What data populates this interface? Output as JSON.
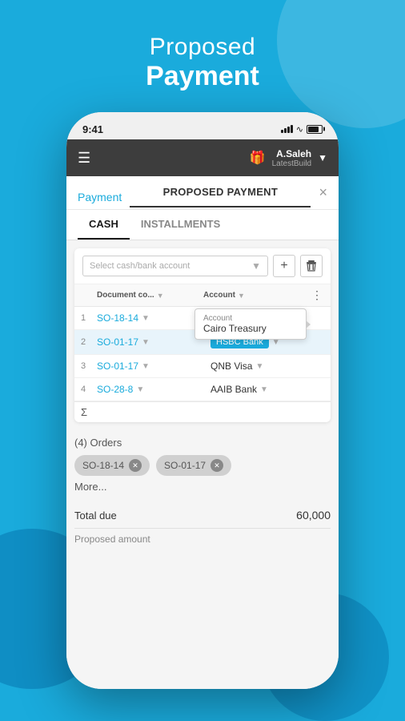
{
  "background_color": "#1AABDC",
  "header": {
    "proposed_label": "Proposed",
    "payment_label": "Payment"
  },
  "phone": {
    "time": "9:41",
    "navbar": {
      "user_name": "A.Saleh",
      "user_sub": "LatestBuild"
    },
    "page": {
      "title_link": "Payment",
      "title_main": "PROPOSED PAYMENT",
      "close_label": "×"
    },
    "tabs": [
      {
        "label": "CASH",
        "active": true
      },
      {
        "label": "INSTALLMENTS",
        "active": false
      }
    ],
    "select_placeholder": "Select cash/bank account",
    "table": {
      "headers": {
        "doc": "Document co...",
        "account": "Account"
      },
      "rows": [
        {
          "num": "1",
          "doc": "SO-18-14",
          "account": "Cairo Treasury",
          "selected": false,
          "has_tooltip": true,
          "tooltip_label": "Account",
          "tooltip_value": "Cairo Treasury"
        },
        {
          "num": "2",
          "doc": "SO-01-17",
          "account": "HSBC Bank",
          "selected": true,
          "has_tooltip": false
        },
        {
          "num": "3",
          "doc": "SO-01-17",
          "account": "QNB Visa",
          "selected": false,
          "has_tooltip": false
        },
        {
          "num": "4",
          "doc": "SO-28-8",
          "account": "AAIB Bank",
          "selected": false,
          "has_tooltip": false
        }
      ]
    },
    "orders": {
      "count_label": "(4) Orders",
      "tags": [
        {
          "label": "SO-18-14"
        },
        {
          "label": "SO-01-17"
        }
      ],
      "more_label": "More..."
    },
    "totals": {
      "total_due_label": "Total due",
      "total_due_value": "60,000",
      "proposed_label": "Proposed amount"
    }
  }
}
